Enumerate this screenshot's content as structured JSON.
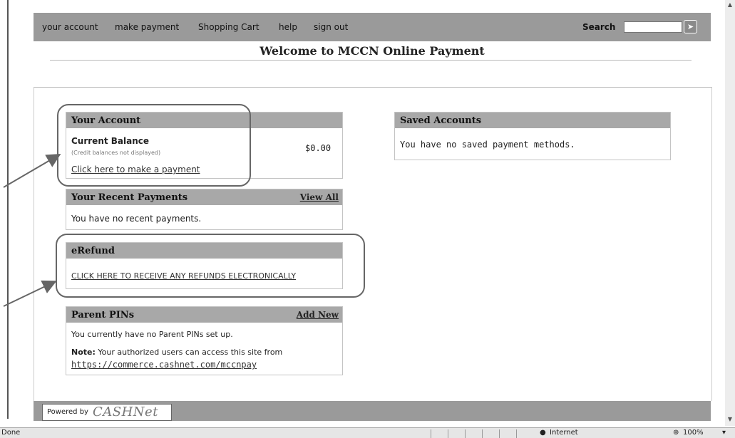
{
  "nav": {
    "links": [
      "your account",
      "make payment",
      "Shopping Cart",
      "help",
      "sign out"
    ],
    "search_label": "Search",
    "search_go": "➤"
  },
  "welcome": "Welcome to MCCN Online Payment",
  "your_account": {
    "title": "Your Account",
    "current_balance_label": "Current Balance",
    "note": "(Credit balances not displayed)",
    "balance": "$0.00",
    "pay_link": "Click here to make a payment"
  },
  "recent_payments": {
    "title": "Your Recent Payments",
    "action": "View All",
    "empty": "You have no recent payments."
  },
  "erefund": {
    "title": "eRefund",
    "link": "CLICK HERE TO RECEIVE ANY REFUNDS ELECTRONICALLY"
  },
  "parent_pins": {
    "title": "Parent PINs",
    "action": "Add New",
    "empty": "You currently have no Parent PINs set up.",
    "note_label": "Note:",
    "note_text": " Your authorized users can access this site from",
    "url": "https://commerce.cashnet.com/mccnpay"
  },
  "saved_accounts": {
    "title": "Saved Accounts",
    "empty": "You have no saved payment methods."
  },
  "footer": {
    "powered_by": "Powered by",
    "brand": "CASHNet"
  },
  "statusbar": {
    "status": "Done",
    "zone": "Internet",
    "zoom": "100%"
  },
  "colors": {
    "nav_bg": "#9a9a9a",
    "panel_head": "#a8a8a8",
    "callout": "#666666"
  }
}
